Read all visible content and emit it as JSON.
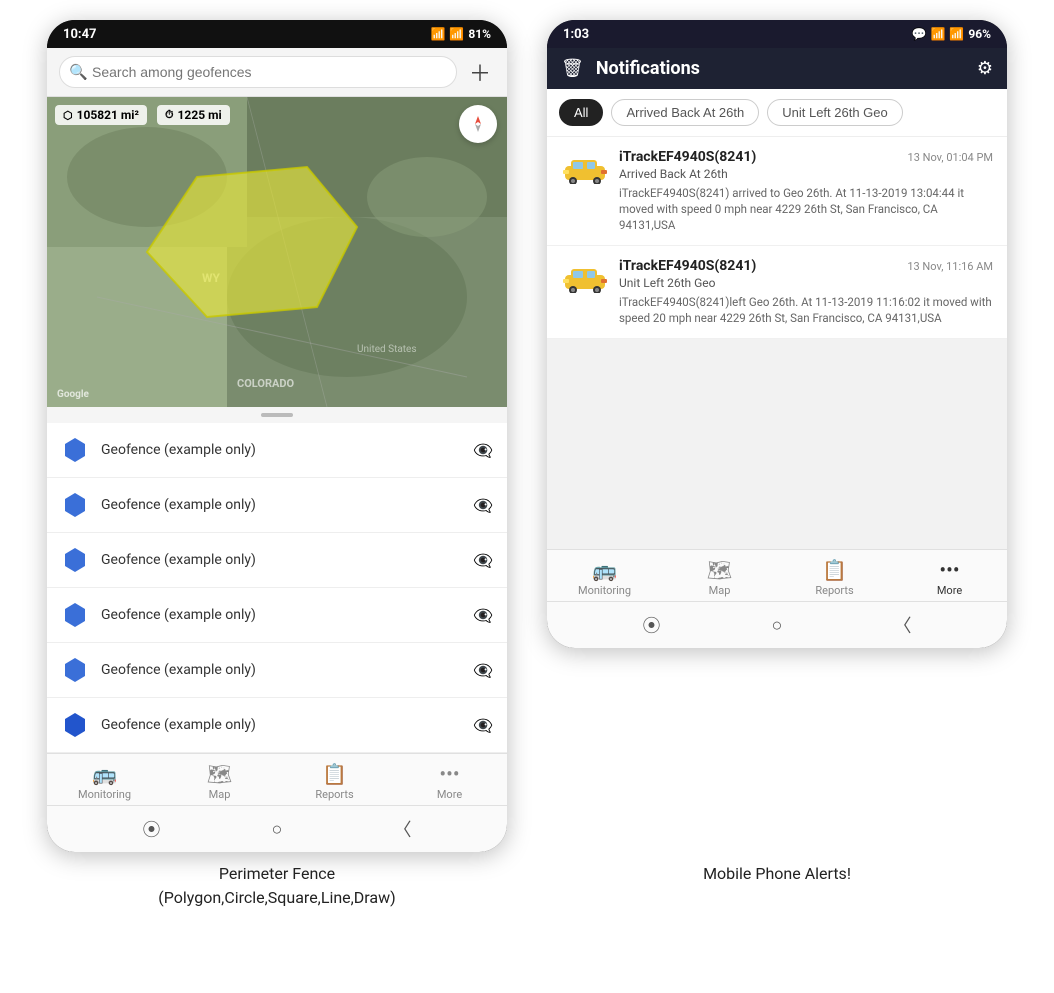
{
  "phone1": {
    "statusBar": {
      "time": "10:47",
      "signal": "WiFi",
      "battery": "81%"
    },
    "search": {
      "placeholder": "Search among geofences"
    },
    "mapStats": {
      "area": "105821 mi²",
      "distance": "1225 mi"
    },
    "geofences": [
      {
        "label": "Geofence (example only)"
      },
      {
        "label": "Geofence (example only)"
      },
      {
        "label": "Geofence (example only)"
      },
      {
        "label": "Geofence (example only)"
      },
      {
        "label": "Geofence (example only)"
      },
      {
        "label": "Geofence (example only)"
      }
    ],
    "bottomNav": [
      {
        "label": "Monitoring",
        "icon": "🚌"
      },
      {
        "label": "Map",
        "icon": "🗺"
      },
      {
        "label": "Reports",
        "icon": "📋"
      },
      {
        "label": "More",
        "icon": "···"
      }
    ],
    "caption": "Perimeter Fence\n(Polygon,Circle,Square,Line,Draw)"
  },
  "phone2": {
    "statusBar": {
      "time": "1:03",
      "signal": "WiFi",
      "battery": "96%"
    },
    "header": {
      "title": "Notifications"
    },
    "filters": [
      "All",
      "Arrived Back At 26th",
      "Unit Left 26th Geo"
    ],
    "notifications": [
      {
        "device": "iTrackEF4940S(8241)",
        "time": "13 Nov, 01:04 PM",
        "event": "Arrived Back At 26th",
        "desc": "iTrackEF4940S(8241) arrived to Geo 26th.    At 11-13-2019 13:04:44 it moved with speed 0 mph near 4229 26th St, San Francisco, CA 94131,USA"
      },
      {
        "device": "iTrackEF4940S(8241)",
        "time": "13 Nov, 11:16 AM",
        "event": "Unit Left 26th Geo",
        "desc": "iTrackEF4940S(8241)left Geo 26th.   At 11-13-2019 11:16:02 it moved with speed 20 mph near 4229 26th St, San Francisco, CA 94131,USA"
      }
    ],
    "bottomNav": [
      {
        "label": "Monitoring",
        "icon": "🚌"
      },
      {
        "label": "Map",
        "icon": "🗺"
      },
      {
        "label": "Reports",
        "icon": "📋"
      },
      {
        "label": "More",
        "icon": "···"
      }
    ],
    "caption": "Mobile Phone Alerts!"
  }
}
